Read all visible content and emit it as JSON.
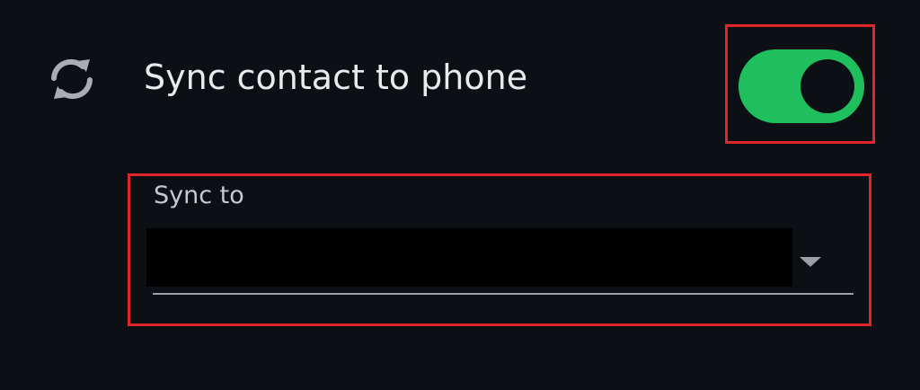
{
  "setting": {
    "icon": "sync-icon",
    "label": "Sync contact to phone",
    "toggle": {
      "state": "on",
      "accent_color": "#1fbf5e"
    }
  },
  "sync_to": {
    "label": "Sync to",
    "value": "",
    "dropdown_icon": "chevron-down-icon"
  },
  "colors": {
    "background": "#0c1014",
    "annotation": "#e0262b"
  }
}
